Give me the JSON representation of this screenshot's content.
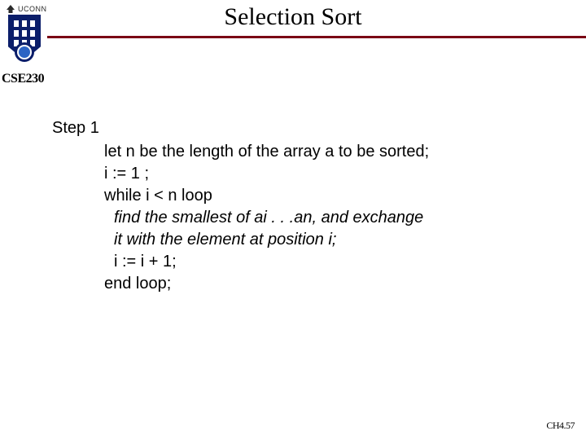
{
  "brand": {
    "uconn": "UCONN"
  },
  "course": "CSE230",
  "title": "Selection Sort",
  "body": {
    "step_label": "Step 1",
    "line1": "let n be the length of the array a to be sorted;",
    "line2": "i := 1 ;",
    "line3": "while i < n loop",
    "line4": "find the  smallest of ai . . .an, and exchange",
    "line5": "it with the element at position i;",
    "line6": "i := i + 1;",
    "line7": "end loop;"
  },
  "footer": "CH4.57"
}
